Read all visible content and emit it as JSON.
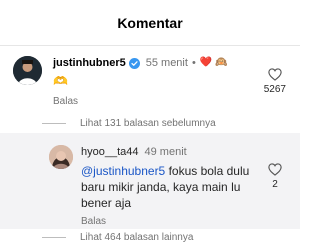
{
  "header": {
    "title": "Komentar"
  },
  "comment": {
    "username": "justinhubner5",
    "time": "55 menit",
    "dot": "•",
    "reaction_emojis": "❤️ 🙉",
    "text": "🫶",
    "reply_label": "Balas",
    "like_count": "5267",
    "view_replies": "Lihat 131 balasan sebelumnya"
  },
  "reply": {
    "username": "hyoo__ta44",
    "time": "49 menit",
    "mention": "@justinhubner5",
    "text": " fokus bola dulu baru mikir janda, kaya main lu bener aja",
    "reply_label": "Balas",
    "like_count": "2",
    "view_more": "Lihat 464 balasan lainnya"
  },
  "colors": {
    "verified": "#3897f0",
    "link": "#1a56c6",
    "muted": "#737373",
    "reply_bg": "#f3f3f5"
  },
  "icons": {
    "verified": "verified-badge-icon",
    "like": "heart-outline-icon"
  }
}
